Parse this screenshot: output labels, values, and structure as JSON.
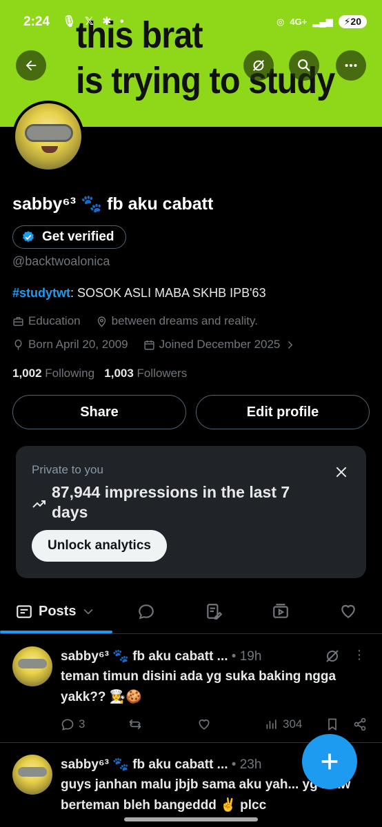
{
  "status": {
    "time": "2:24",
    "left_icons": "🎙 𝕏 ✱ •",
    "network": "4G+",
    "battery": "20"
  },
  "banner": {
    "line1": "this brat",
    "line2": "is trying to study"
  },
  "profile": {
    "name": "sabby⁶³ 🐾 fb aku cabatt",
    "verify_label": "Get verified",
    "handle": "@backtwoalonica",
    "bio_tag": "#studytwt",
    "bio_rest": ": SOSOK ASLI MABA SKHB IPB'63",
    "category": "Education",
    "location": "between dreams and reality.",
    "born": "Born April 20, 2009",
    "joined": "Joined December 2025",
    "following_count": "1,002",
    "following_label": "Following",
    "followers_count": "1,003",
    "followers_label": "Followers"
  },
  "buttons": {
    "share": "Share",
    "edit": "Edit profile"
  },
  "analytics": {
    "label": "Private to you",
    "impressions": "87,944 impressions in the last 7 days",
    "unlock": "Unlock analytics"
  },
  "tabs": {
    "posts": "Posts"
  },
  "posts": [
    {
      "name": "sabby⁶³ 🐾 fb aku cabatt ...",
      "time": "• 19h",
      "text": "teman timun disini ada yg suka baking ngga yakk?? 👩‍🍳🍪",
      "replies": "3",
      "views": "304"
    },
    {
      "name": "sabby⁶³ 🐾 fb aku cabatt ...",
      "time": "• 23h",
      "text": "guys janhan malu jbjb sama aku yah... yg maw berteman bleh bangeddd ✌️ plcc"
    }
  ],
  "colors": {
    "banner": "#8fd719",
    "accent": "#1d9bf0",
    "background": "#000000",
    "card": "#202327"
  }
}
